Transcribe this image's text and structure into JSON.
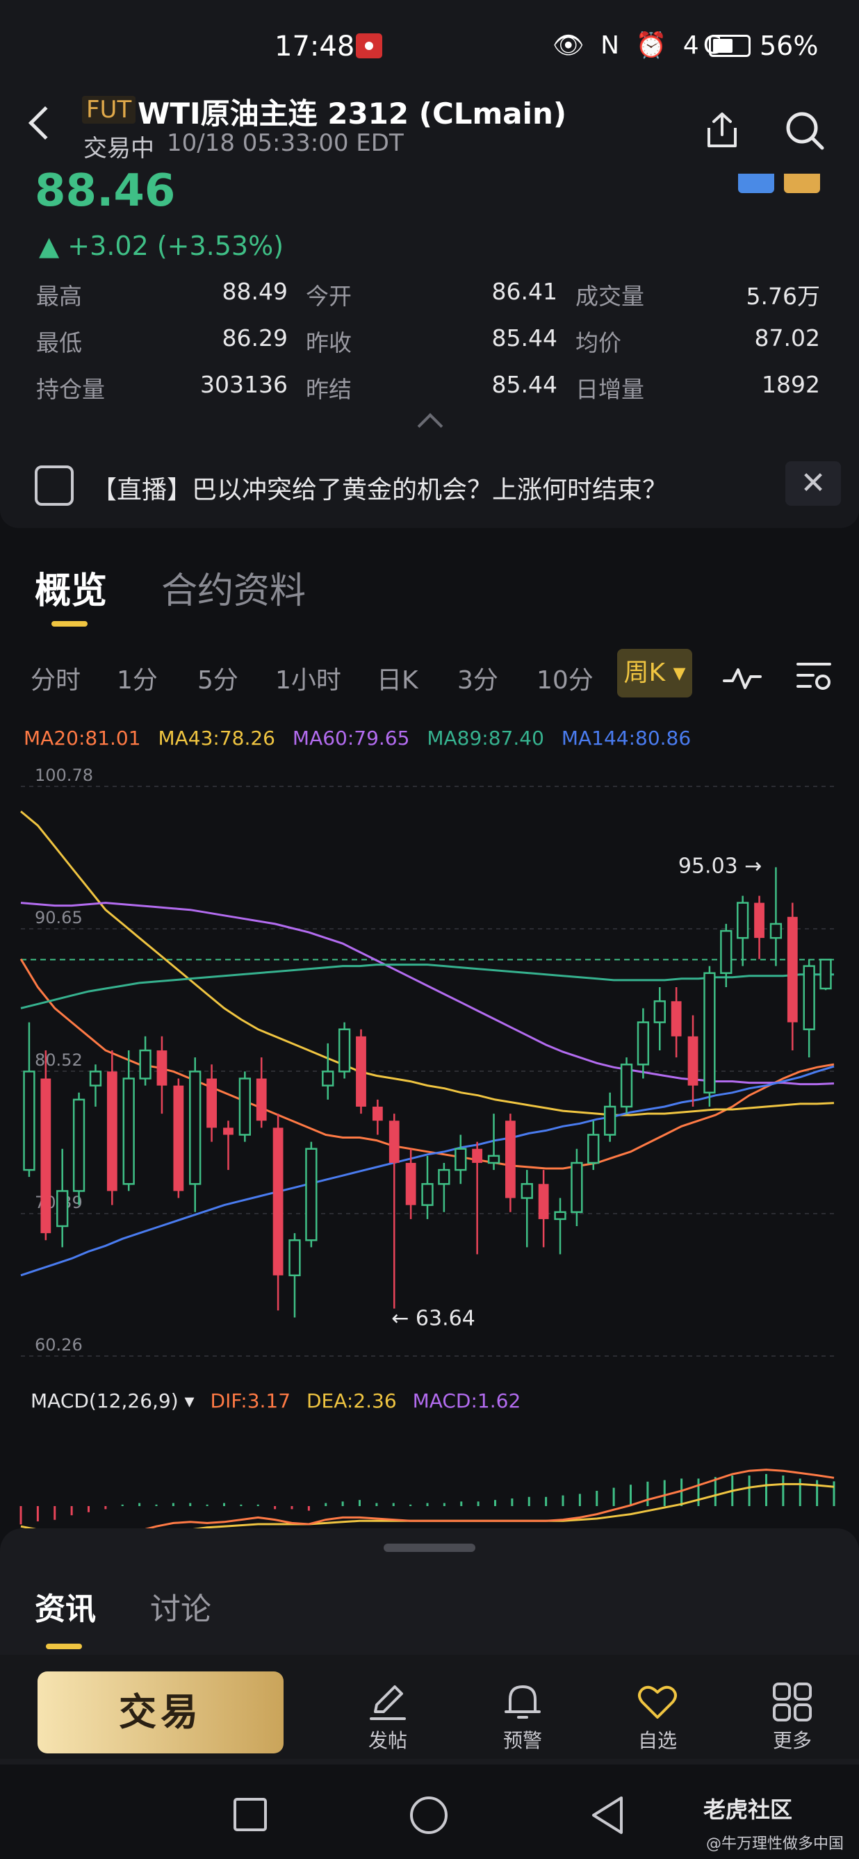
{
  "status_bar": {
    "time": "17:48",
    "icons": "👁 N ⏰ 4G",
    "battery_pct": "56%",
    "battery_level": 0.56
  },
  "header": {
    "badge": "FUT",
    "title": "WTI原油主连 2312 (CLmain)",
    "trade_status": "交易中",
    "timestamp": "10/18 05:33:00 EDT"
  },
  "quote": {
    "price": "88.46",
    "change": "▲ +3.02 (+3.53%)",
    "stats": [
      {
        "label": "最高",
        "value": "88.49"
      },
      {
        "label": "今开",
        "value": "86.41"
      },
      {
        "label": "成交量",
        "value": "5.76万"
      },
      {
        "label": "最低",
        "value": "86.29"
      },
      {
        "label": "昨收",
        "value": "85.44"
      },
      {
        "label": "均价",
        "value": "87.02"
      },
      {
        "label": "持仓量",
        "value": "303136"
      },
      {
        "label": "昨结",
        "value": "85.44"
      },
      {
        "label": "日增量",
        "value": "1892"
      }
    ]
  },
  "news_banner": {
    "text": "【直播】巴以冲突给了黄金的机会？上涨何时结束？",
    "close": "✕"
  },
  "tabs": {
    "overview": "概览",
    "contract": "合约资料"
  },
  "periods": [
    "分时",
    "1分",
    "5分",
    "1小时",
    "日K",
    "3分",
    "10分"
  ],
  "period_selected": "周K ▾",
  "ma_legend": [
    {
      "text": "MA20:81.01",
      "color": "#ff7a45"
    },
    {
      "text": "MA43:78.26",
      "color": "#f0c541"
    },
    {
      "text": "MA60:79.65",
      "color": "#b36cf0"
    },
    {
      "text": "MA89:87.40",
      "color": "#36b28f"
    },
    {
      "text": "MA144:80.86",
      "color": "#4a7cf0"
    }
  ],
  "macd_legend": [
    {
      "text": "MACD(12,26,9) ▾",
      "color": "#e8e8ea"
    },
    {
      "text": "DIF:3.17",
      "color": "#ff7a45"
    },
    {
      "text": "DEA:2.36",
      "color": "#f0c541"
    },
    {
      "text": "MACD:1.62",
      "color": "#b36cf0"
    }
  ],
  "chart_data": {
    "type": "candlestick",
    "y_ticks": [
      "100.78",
      "90.65",
      "80.52",
      "70.39",
      "60.26"
    ],
    "ylim": [
      60.26,
      100.78
    ],
    "last_price": 88.46,
    "high_label": "95.03 →",
    "low_label": "← 63.64",
    "colors": {
      "up": "#3fbf86",
      "down": "#e84459"
    },
    "candles": [
      {
        "o": 73.5,
        "h": 84.0,
        "l": 73.0,
        "c": 80.5
      },
      {
        "o": 80.0,
        "h": 82.0,
        "l": 68.5,
        "c": 69.0
      },
      {
        "o": 69.5,
        "h": 75.0,
        "l": 68.0,
        "c": 72.0
      },
      {
        "o": 72.0,
        "h": 79.0,
        "l": 71.0,
        "c": 78.5
      },
      {
        "o": 79.5,
        "h": 81.0,
        "l": 78.0,
        "c": 80.5
      },
      {
        "o": 80.5,
        "h": 82.0,
        "l": 71.0,
        "c": 72.0
      },
      {
        "o": 72.5,
        "h": 82.0,
        "l": 72.0,
        "c": 80.0
      },
      {
        "o": 80.0,
        "h": 83.0,
        "l": 79.5,
        "c": 82.0
      },
      {
        "o": 82.0,
        "h": 83.0,
        "l": 77.5,
        "c": 79.5
      },
      {
        "o": 79.5,
        "h": 80.0,
        "l": 71.5,
        "c": 72.0
      },
      {
        "o": 72.5,
        "h": 81.5,
        "l": 70.5,
        "c": 80.5
      },
      {
        "o": 80.0,
        "h": 81.0,
        "l": 75.5,
        "c": 76.5
      },
      {
        "o": 76.5,
        "h": 77.0,
        "l": 73.5,
        "c": 76.0
      },
      {
        "o": 76.0,
        "h": 80.5,
        "l": 75.5,
        "c": 80.0
      },
      {
        "o": 80.0,
        "h": 81.5,
        "l": 76.5,
        "c": 77.0
      },
      {
        "o": 76.5,
        "h": 77.5,
        "l": 63.5,
        "c": 66.0
      },
      {
        "o": 66.0,
        "h": 69.0,
        "l": 63.0,
        "c": 68.5
      },
      {
        "o": 68.5,
        "h": 75.5,
        "l": 68.0,
        "c": 75.0
      },
      {
        "o": 79.5,
        "h": 82.5,
        "l": 78.5,
        "c": 80.5
      },
      {
        "o": 80.5,
        "h": 84.0,
        "l": 80.0,
        "c": 83.5
      },
      {
        "o": 83.0,
        "h": 83.5,
        "l": 77.5,
        "c": 78.0
      },
      {
        "o": 78.0,
        "h": 78.5,
        "l": 76.0,
        "c": 77.0
      },
      {
        "o": 77.0,
        "h": 77.5,
        "l": 63.64,
        "c": 74.0
      },
      {
        "o": 74.0,
        "h": 75.0,
        "l": 70.0,
        "c": 71.0
      },
      {
        "o": 71.0,
        "h": 74.5,
        "l": 70.0,
        "c": 72.5
      },
      {
        "o": 72.5,
        "h": 74.0,
        "l": 70.5,
        "c": 73.5
      },
      {
        "o": 73.5,
        "h": 76.0,
        "l": 72.5,
        "c": 75.0
      },
      {
        "o": 75.0,
        "h": 75.5,
        "l": 67.5,
        "c": 74.0
      },
      {
        "o": 74.0,
        "h": 77.5,
        "l": 73.5,
        "c": 74.5
      },
      {
        "o": 77.0,
        "h": 77.5,
        "l": 70.5,
        "c": 71.5
      },
      {
        "o": 71.5,
        "h": 73.5,
        "l": 68.0,
        "c": 72.5
      },
      {
        "o": 72.5,
        "h": 73.5,
        "l": 68.0,
        "c": 70.0
      },
      {
        "o": 70.0,
        "h": 71.5,
        "l": 67.5,
        "c": 70.5
      },
      {
        "o": 70.5,
        "h": 75.0,
        "l": 69.5,
        "c": 74.0
      },
      {
        "o": 74.0,
        "h": 77.0,
        "l": 73.5,
        "c": 76.0
      },
      {
        "o": 76.0,
        "h": 79.0,
        "l": 75.5,
        "c": 78.0
      },
      {
        "o": 78.0,
        "h": 81.5,
        "l": 77.5,
        "c": 81.0
      },
      {
        "o": 81.0,
        "h": 85.0,
        "l": 80.0,
        "c": 84.0
      },
      {
        "o": 84.0,
        "h": 86.5,
        "l": 82.0,
        "c": 85.5
      },
      {
        "o": 85.5,
        "h": 86.5,
        "l": 81.5,
        "c": 83.0
      },
      {
        "o": 83.0,
        "h": 84.5,
        "l": 78.0,
        "c": 79.5
      },
      {
        "o": 79.0,
        "h": 88.0,
        "l": 78.0,
        "c": 87.5
      },
      {
        "o": 87.5,
        "h": 91.0,
        "l": 86.5,
        "c": 90.5
      },
      {
        "o": 90.0,
        "h": 93.0,
        "l": 88.0,
        "c": 92.5
      },
      {
        "o": 92.5,
        "h": 93.0,
        "l": 88.5,
        "c": 90.0
      },
      {
        "o": 90.0,
        "h": 95.03,
        "l": 88.0,
        "c": 91.0
      },
      {
        "o": 91.5,
        "h": 92.5,
        "l": 82.0,
        "c": 84.0
      },
      {
        "o": 83.5,
        "h": 88.5,
        "l": 81.5,
        "c": 88.0
      },
      {
        "o": 86.4,
        "h": 88.49,
        "l": 86.29,
        "c": 88.46
      }
    ],
    "ma_lines": [
      {
        "name": "MA20",
        "color": "#ff7a45",
        "values": [
          88.5,
          86.5,
          85.0,
          84.0,
          83.0,
          82.0,
          81.5,
          81.0,
          80.8,
          80.5,
          80.0,
          79.5,
          79.0,
          78.5,
          78.0,
          77.5,
          77.0,
          76.5,
          76.0,
          75.8,
          75.8,
          75.6,
          75.2,
          75.0,
          74.8,
          74.6,
          74.4,
          74.2,
          74.0,
          73.8,
          73.7,
          73.6,
          73.6,
          73.8,
          74.0,
          74.4,
          74.8,
          75.4,
          76.0,
          76.6,
          77.0,
          77.4,
          78.0,
          78.8,
          79.4,
          80.0,
          80.5,
          80.8,
          81.01
        ]
      },
      {
        "name": "MA43",
        "color": "#f0c541",
        "values": [
          99.0,
          98.0,
          96.5,
          95.0,
          93.5,
          92.0,
          91.0,
          90.0,
          89.0,
          88.0,
          87.0,
          86.0,
          85.0,
          84.2,
          83.5,
          83.0,
          82.5,
          82.0,
          81.5,
          81.0,
          80.5,
          80.2,
          80.0,
          79.8,
          79.5,
          79.3,
          79.0,
          78.8,
          78.5,
          78.3,
          78.1,
          77.9,
          77.7,
          77.6,
          77.5,
          77.4,
          77.4,
          77.5,
          77.5,
          77.6,
          77.7,
          77.8,
          77.8,
          77.9,
          78.0,
          78.1,
          78.2,
          78.2,
          78.26
        ]
      },
      {
        "name": "MA60",
        "color": "#b36cf0",
        "values": [
          92.5,
          92.4,
          92.3,
          92.3,
          92.4,
          92.5,
          92.4,
          92.3,
          92.2,
          92.1,
          92.0,
          91.8,
          91.6,
          91.4,
          91.2,
          91.0,
          90.7,
          90.4,
          90.0,
          89.6,
          89.0,
          88.4,
          87.8,
          87.2,
          86.6,
          86.0,
          85.4,
          84.8,
          84.2,
          83.6,
          83.0,
          82.4,
          81.9,
          81.5,
          81.1,
          80.8,
          80.6,
          80.4,
          80.2,
          80.0,
          79.9,
          79.8,
          79.8,
          79.7,
          79.7,
          79.7,
          79.6,
          79.6,
          79.65
        ]
      },
      {
        "name": "MA89",
        "color": "#36b28f",
        "values": [
          85.0,
          85.3,
          85.6,
          85.9,
          86.2,
          86.4,
          86.6,
          86.8,
          86.9,
          87.0,
          87.1,
          87.2,
          87.3,
          87.4,
          87.5,
          87.6,
          87.7,
          87.8,
          87.9,
          88.0,
          88.0,
          88.1,
          88.1,
          88.1,
          88.1,
          88.0,
          87.9,
          87.8,
          87.7,
          87.6,
          87.5,
          87.4,
          87.3,
          87.2,
          87.1,
          87.0,
          87.0,
          87.0,
          87.0,
          87.1,
          87.1,
          87.2,
          87.2,
          87.3,
          87.3,
          87.3,
          87.4,
          87.4,
          87.4
        ]
      },
      {
        "name": "MA144",
        "color": "#4a7cf0",
        "values": [
          66.0,
          66.4,
          66.8,
          67.2,
          67.7,
          68.1,
          68.6,
          69.0,
          69.4,
          69.8,
          70.2,
          70.6,
          71.0,
          71.3,
          71.6,
          71.9,
          72.2,
          72.5,
          72.8,
          73.1,
          73.4,
          73.7,
          74.0,
          74.3,
          74.6,
          74.8,
          75.1,
          75.3,
          75.6,
          75.8,
          76.1,
          76.3,
          76.6,
          76.8,
          77.1,
          77.3,
          77.6,
          77.8,
          78.0,
          78.3,
          78.5,
          78.8,
          79.0,
          79.3,
          79.5,
          79.8,
          80.1,
          80.5,
          80.86
        ]
      }
    ],
    "macd_hist": [
      -1.2,
      -1.0,
      -0.9,
      -0.6,
      -0.4,
      -0.2,
      0.1,
      0.2,
      0.1,
      0.2,
      0.2,
      0.1,
      0.2,
      0.1,
      0.1,
      -0.2,
      -0.2,
      -0.3,
      0.2,
      0.3,
      0.4,
      0.2,
      0.2,
      0.1,
      0.2,
      0.2,
      0.3,
      0.3,
      0.4,
      0.5,
      0.6,
      0.6,
      0.7,
      0.8,
      1.0,
      1.2,
      1.4,
      1.6,
      1.7,
      1.8,
      1.8,
      1.9,
      2.0,
      2.0,
      2.1,
      2.0,
      1.8,
      1.7,
      1.62
    ],
    "macd_dif": [
      -2.0,
      -2.3,
      -2.5,
      -2.6,
      -2.5,
      -2.3,
      -2.0,
      -1.6,
      -1.2,
      -0.9,
      -0.8,
      -0.9,
      -0.8,
      -0.6,
      -0.4,
      -0.6,
      -0.9,
      -1.0,
      -0.6,
      -0.4,
      -0.4,
      -0.5,
      -0.6,
      -0.7,
      -0.7,
      -0.7,
      -0.7,
      -0.7,
      -0.7,
      -0.7,
      -0.7,
      -0.7,
      -0.6,
      -0.4,
      -0.1,
      0.3,
      0.7,
      1.2,
      1.6,
      2.0,
      2.5,
      3.0,
      3.5,
      3.8,
      3.9,
      3.8,
      3.6,
      3.4,
      3.17
    ],
    "macd_dea": [
      -1.2,
      -1.5,
      -1.8,
      -2.0,
      -2.1,
      -2.2,
      -2.2,
      -2.1,
      -1.9,
      -1.7,
      -1.5,
      -1.3,
      -1.2,
      -1.1,
      -1.0,
      -1.0,
      -1.0,
      -1.0,
      -0.9,
      -0.8,
      -0.7,
      -0.7,
      -0.7,
      -0.7,
      -0.7,
      -0.7,
      -0.7,
      -0.7,
      -0.7,
      -0.7,
      -0.7,
      -0.7,
      -0.7,
      -0.6,
      -0.5,
      -0.3,
      -0.1,
      0.2,
      0.5,
      0.8,
      1.2,
      1.6,
      2.0,
      2.3,
      2.5,
      2.6,
      2.6,
      2.5,
      2.36
    ]
  },
  "bottom_sheet": {
    "tab_news": "资讯",
    "tab_discuss": "讨论"
  },
  "actions": {
    "trade": "交易",
    "post": "发帖",
    "alert": "预警",
    "watchlist": "自选",
    "more": "更多"
  },
  "watermark": {
    "brand": "老虎社区",
    "sub": "@牛万理性做多中国"
  }
}
